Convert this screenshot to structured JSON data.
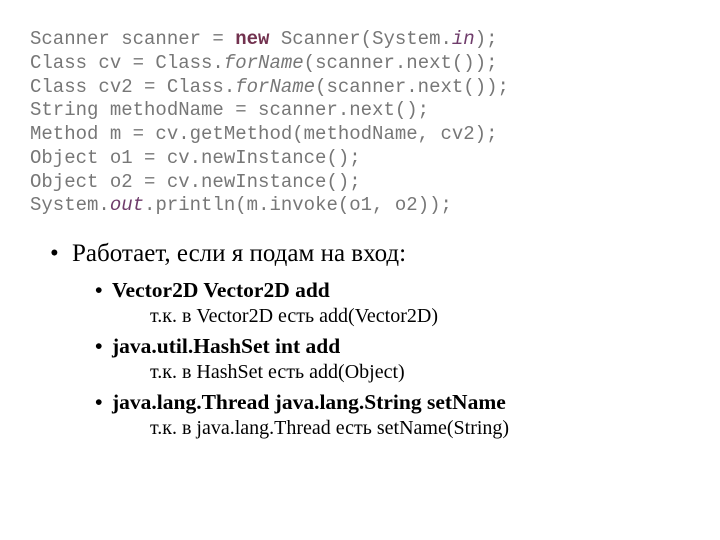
{
  "code": {
    "l1a": "Scanner scanner = ",
    "l1b": "new",
    "l1c": " Scanner(System.",
    "l1d": "in",
    "l1e": ");",
    "l2a": "Class cv = Class.",
    "l2b": "forName",
    "l2c": "(scanner.next());",
    "l3a": "Class cv2 = Class.",
    "l3b": "forName",
    "l3c": "(scanner.next());",
    "l4": "String methodName = scanner.next();",
    "l5": "Method m = cv.getMethod(methodName, cv2);",
    "l6": "Object o1 = cv.newInstance();",
    "l7": "Object o2 = cv.newInstance();",
    "l8a": "System.",
    "l8b": "out",
    "l8c": ".println(m.invoke(o1, o2));"
  },
  "text": {
    "heading": "Работает, если я подам на вход:",
    "items": [
      {
        "title": "Vector2D  Vector2D  add",
        "sub": "т.к. в Vector2D есть add(Vector2D)"
      },
      {
        "title": "java.util.HashSet  int  add",
        "sub": "т.к. в HashSet есть add(Object)"
      },
      {
        "title": "java.lang.Thread  java.lang.String  setName",
        "sub": "т.к. в java.lang.Thread есть setName(String)"
      }
    ]
  }
}
